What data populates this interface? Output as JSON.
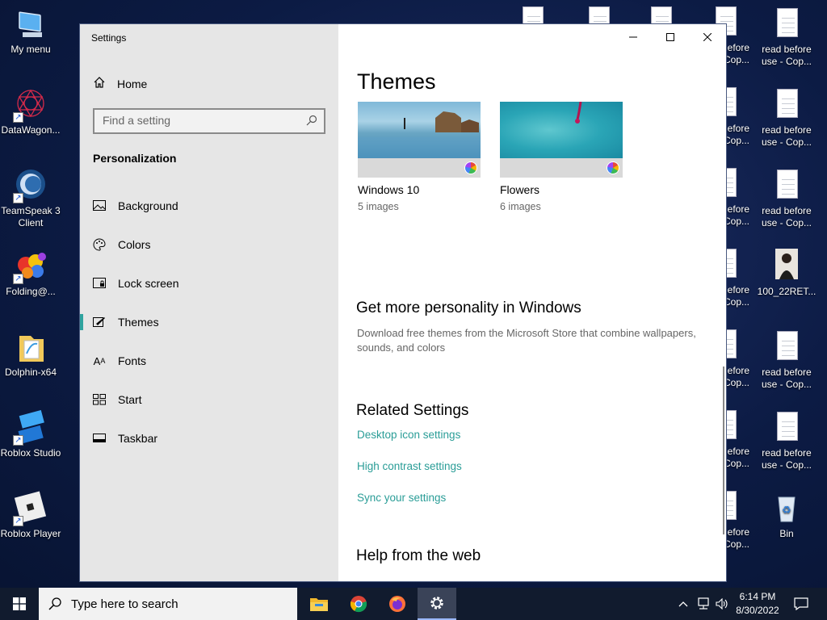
{
  "desktop": {
    "left_icons": [
      {
        "label": "My menu",
        "icon": "monitor-icon"
      },
      {
        "label": "DataWagon...",
        "icon": "datawagon-icon"
      },
      {
        "label": "TeamSpeak 3 Client",
        "icon": "teamspeak-icon"
      },
      {
        "label": "Folding@...",
        "icon": "folding-icon"
      },
      {
        "label": "Dolphin-x64",
        "icon": "folder-icon"
      },
      {
        "label": "Roblox Studio",
        "icon": "roblox-studio-icon"
      },
      {
        "label": "Roblox Player",
        "icon": "roblox-player-icon"
      }
    ],
    "right_col1": [
      {
        "label": "",
        "icon": "document-icon"
      },
      {
        "label": "efore Cop...",
        "icon": "document-icon"
      },
      {
        "label": "efore Cop...",
        "icon": "document-icon"
      },
      {
        "label": "efore Cop...",
        "icon": "document-icon"
      },
      {
        "label": "efore Cop...",
        "icon": "document-icon"
      },
      {
        "label": "efore Cop...",
        "icon": "document-icon"
      },
      {
        "label": "efore Cop...",
        "icon": "document-icon"
      },
      {
        "label": "efore Cop...",
        "icon": "document-icon"
      }
    ],
    "right_col2": [
      {
        "label": "read before use - Cop...",
        "icon": "document-icon"
      },
      {
        "label": "read before use - Cop...",
        "icon": "document-icon"
      },
      {
        "label": "read before use - Cop...",
        "icon": "document-icon"
      },
      {
        "label": "100_22RET...",
        "icon": "photo-icon"
      },
      {
        "label": "read before use - Cop...",
        "icon": "document-icon"
      },
      {
        "label": "read before use - Cop...",
        "icon": "document-icon"
      },
      {
        "label": "Bin",
        "icon": "recycle-bin-icon"
      }
    ]
  },
  "window": {
    "title": "Settings",
    "controls": {
      "minimize": "minimize-icon",
      "maximize": "maximize-icon",
      "close": "close-icon"
    }
  },
  "sidebar": {
    "home_label": "Home",
    "search_placeholder": "Find a setting",
    "section_title": "Personalization",
    "items": [
      {
        "label": "Background",
        "icon": "picture-icon",
        "selected": false
      },
      {
        "label": "Colors",
        "icon": "palette-icon",
        "selected": false
      },
      {
        "label": "Lock screen",
        "icon": "lock-screen-icon",
        "selected": false
      },
      {
        "label": "Themes",
        "icon": "brush-icon",
        "selected": true
      },
      {
        "label": "Fonts",
        "icon": "fonts-icon",
        "selected": false
      },
      {
        "label": "Start",
        "icon": "start-icon",
        "selected": false
      },
      {
        "label": "Taskbar",
        "icon": "taskbar-icon",
        "selected": false
      }
    ]
  },
  "main": {
    "heading": "Themes",
    "themes": [
      {
        "name": "Windows 10",
        "count": "5 images"
      },
      {
        "name": "Flowers",
        "count": "6 images"
      }
    ],
    "personality_heading": "Get more personality in Windows",
    "personality_desc": "Download free themes from the Microsoft Store that combine wallpapers, sounds, and colors",
    "related_heading": "Related Settings",
    "related_links": [
      "Desktop icon settings",
      "High contrast settings",
      "Sync your settings"
    ],
    "help_heading": "Help from the web"
  },
  "taskbar": {
    "search_placeholder": "Type here to search",
    "apps": [
      "file-explorer-icon",
      "chrome-icon",
      "firefox-icon",
      "settings-gear-icon"
    ],
    "time": "6:14 PM",
    "date": "8/30/2022"
  },
  "colors": {
    "accent": "#2a9d97",
    "sidebar": "#e6e6e6",
    "taskbar": "#111b2e"
  }
}
